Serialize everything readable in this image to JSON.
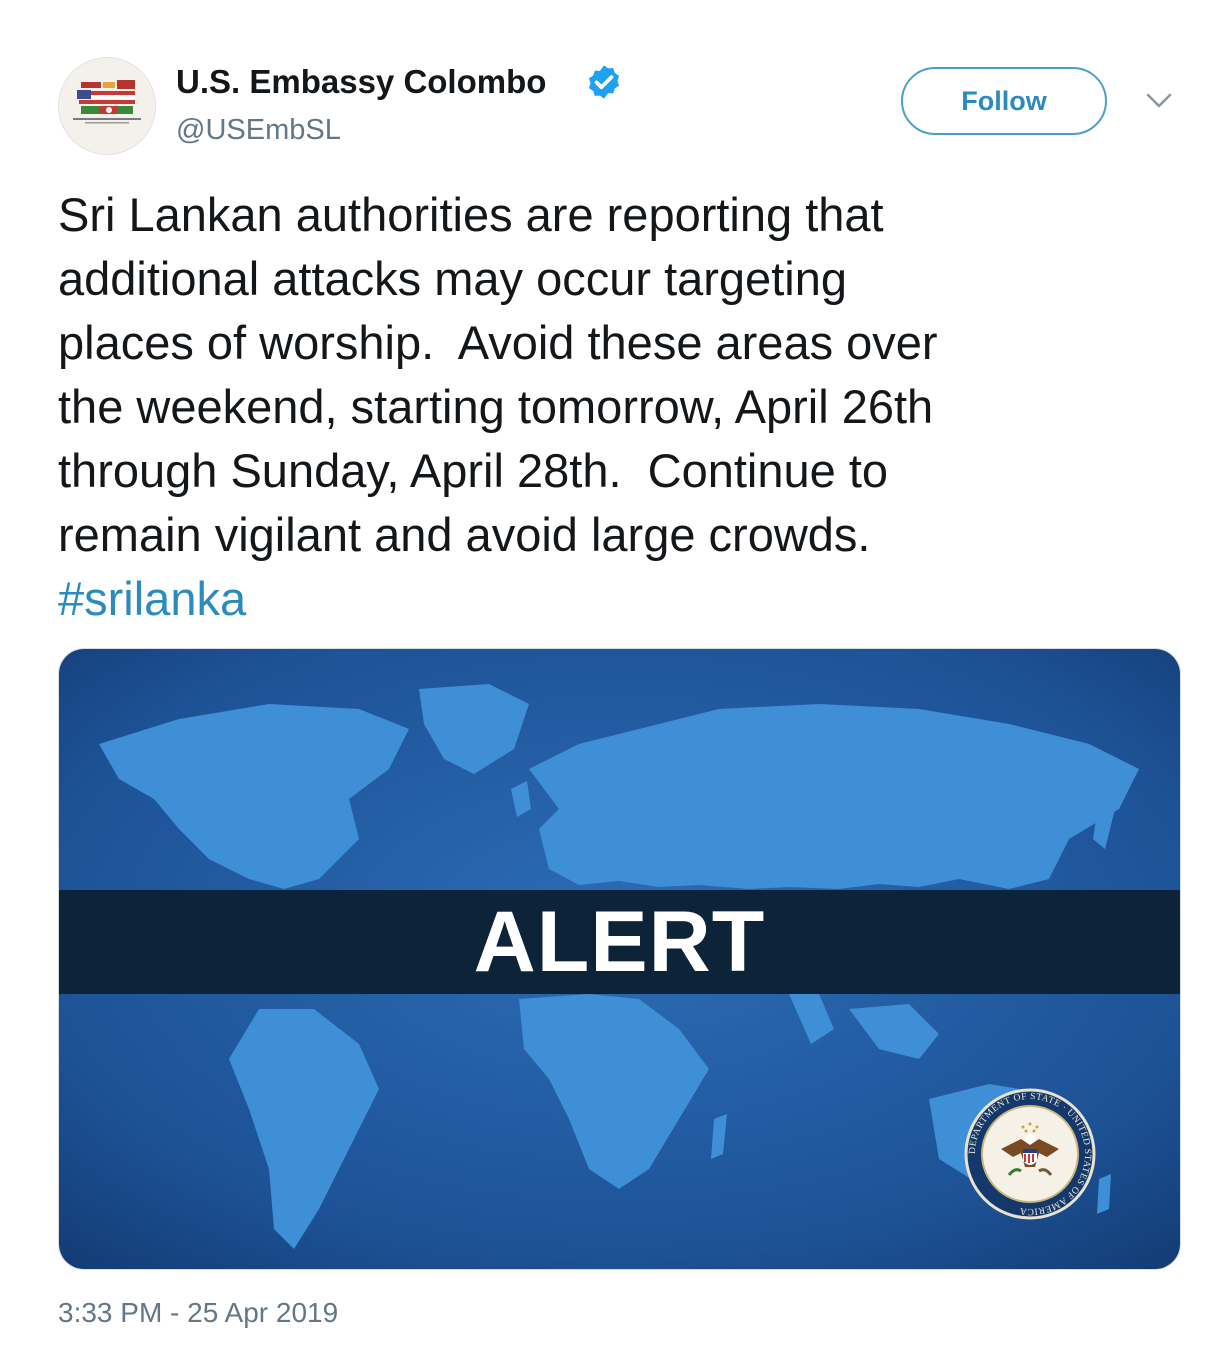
{
  "tweet": {
    "author": {
      "display_name": "U.S. Embassy Colombo",
      "handle": "@USEmbSL",
      "verified": true,
      "avatar_icon": "embassy-flags-logo"
    },
    "follow_label": "Follow",
    "menu_icon": "chevron-down-icon",
    "text": "Sri Lankan authorities are reporting that\nadditional attacks may occur targeting\nplaces of worship.  Avoid these areas over\nthe weekend, starting tomorrow, April 26th\nthrough Sunday, April 28th.  Continue to\nremain vigilant and avoid large crowds.\n",
    "hashtag": "#srilanka",
    "media": {
      "alert_text": "ALERT",
      "seal_text": "DEPARTMENT OF STATE · UNITED STATES OF AMERICA",
      "seal_icon": "department-of-state-seal"
    },
    "timestamp": "3:33 PM - 25 Apr 2019"
  },
  "colors": {
    "text": "#14171a",
    "secondary": "#657786",
    "link": "#2b8bbd",
    "verified": "#1da1f2",
    "alert_band": "#0d2338",
    "map_ocean": "#1f5aa0",
    "map_land": "#3f8fd6"
  }
}
